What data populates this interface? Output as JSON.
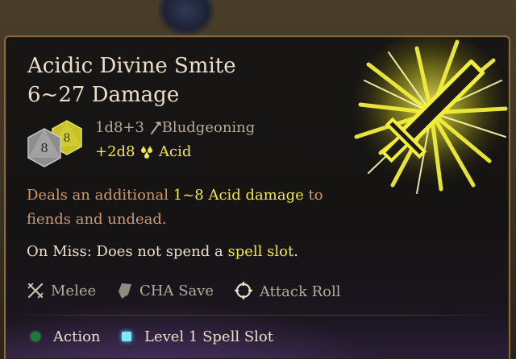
{
  "tooltip": {
    "title": "Acidic Divine Smite",
    "damage_range": "6~27 Damage",
    "dice": [
      {
        "label": "8",
        "color": "#8d8d8d",
        "icon": "d8-die-grey-icon"
      },
      {
        "label": "8",
        "color": "#c6c02a",
        "icon": "d8-die-yellow-icon"
      }
    ],
    "damage_lines": [
      {
        "formula": "1d8+3",
        "type": "Bludgeoning",
        "icon": "hammer-icon",
        "color": "#b5aa97"
      },
      {
        "formula": "+2d8",
        "type": "Acid",
        "icon": "acid-drops-icon",
        "color": "#f0ea3c"
      }
    ],
    "description": {
      "prefix": "Deals an additional ",
      "highlight": "1~8 Acid damage",
      "suffix": " to fiends and undead."
    },
    "on_miss": {
      "prefix": "On Miss: Does not spend a ",
      "highlight": "spell slot",
      "suffix": "."
    },
    "properties": [
      {
        "label": "Melee",
        "icon": "crossed-swords-icon"
      },
      {
        "label": "CHA Save",
        "icon": "shield-icon"
      },
      {
        "label": "Attack Roll",
        "icon": "crosshair-icon"
      }
    ],
    "costs": [
      {
        "label": "Action",
        "icon": "action-dot-icon",
        "color": "#1f7a3a"
      },
      {
        "label": "Level 1 Spell Slot",
        "icon": "spell-slot-icon",
        "color": "#7fe6ff"
      }
    ],
    "spell_icon": "glowing-sword-smite-icon",
    "colors": {
      "highlight": "#f0ea3c",
      "description": "#d09a6a",
      "body_text": "#ecdfca",
      "muted_text": "#b5aa97",
      "border": "#8a6a3e"
    }
  }
}
